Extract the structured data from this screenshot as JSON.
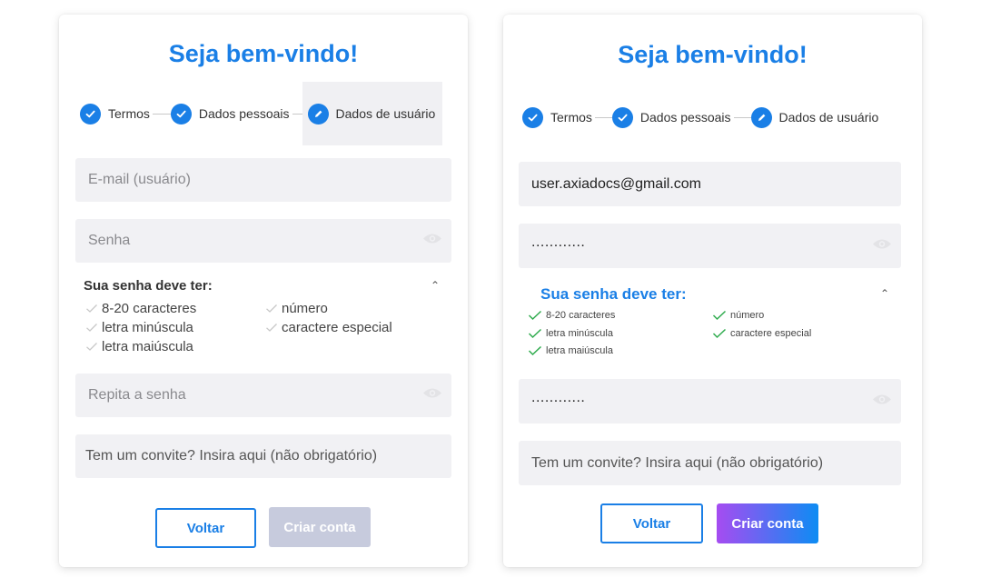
{
  "colors": {
    "accent": "#1a7fe6",
    "field_bg": "#f1f1f4",
    "check_active": "#2eab4d",
    "check_inactive": "#c8c8c8",
    "disabled_button": "#c7cbdd",
    "gradient_start": "#a64cf1",
    "gradient_end": "#0d8cf3"
  },
  "left": {
    "title": "Seja bem-vindo!",
    "steps": [
      {
        "label": "Termos",
        "icon": "check-icon"
      },
      {
        "label": "Dados pessoais",
        "icon": "check-icon"
      },
      {
        "label": "Dados de usuário",
        "icon": "pencil-icon"
      }
    ],
    "email_placeholder": "E-mail (usuário)",
    "password_placeholder": "Senha",
    "rules_title": "Sua senha deve ter:",
    "rules": [
      "8-20 caracteres",
      "número",
      "letra minúscula",
      "caractere especial",
      "letra maiúscula"
    ],
    "repeat_placeholder": "Repita a senha",
    "invite_placeholder": "Tem um convite? Insira aqui (não obrigatório)",
    "back_label": "Voltar",
    "create_label": "Criar conta"
  },
  "right": {
    "title": "Seja bem-vindo!",
    "steps": [
      {
        "label": "Termos",
        "icon": "check-icon"
      },
      {
        "label": "Dados pessoais",
        "icon": "check-icon"
      },
      {
        "label": "Dados de usuário",
        "icon": "pencil-icon"
      }
    ],
    "email_value": "user.axiadocs@gmail.com",
    "password_value": "............",
    "rules_title": "Sua senha deve ter:",
    "rules": [
      "8-20 caracteres",
      "número",
      "letra minúscula",
      "caractere especial",
      "letra maiúscula"
    ],
    "repeat_value": "............",
    "invite_placeholder": "Tem um convite? Insira aqui (não obrigatório)",
    "back_label": "Voltar",
    "create_label": "Criar conta"
  }
}
